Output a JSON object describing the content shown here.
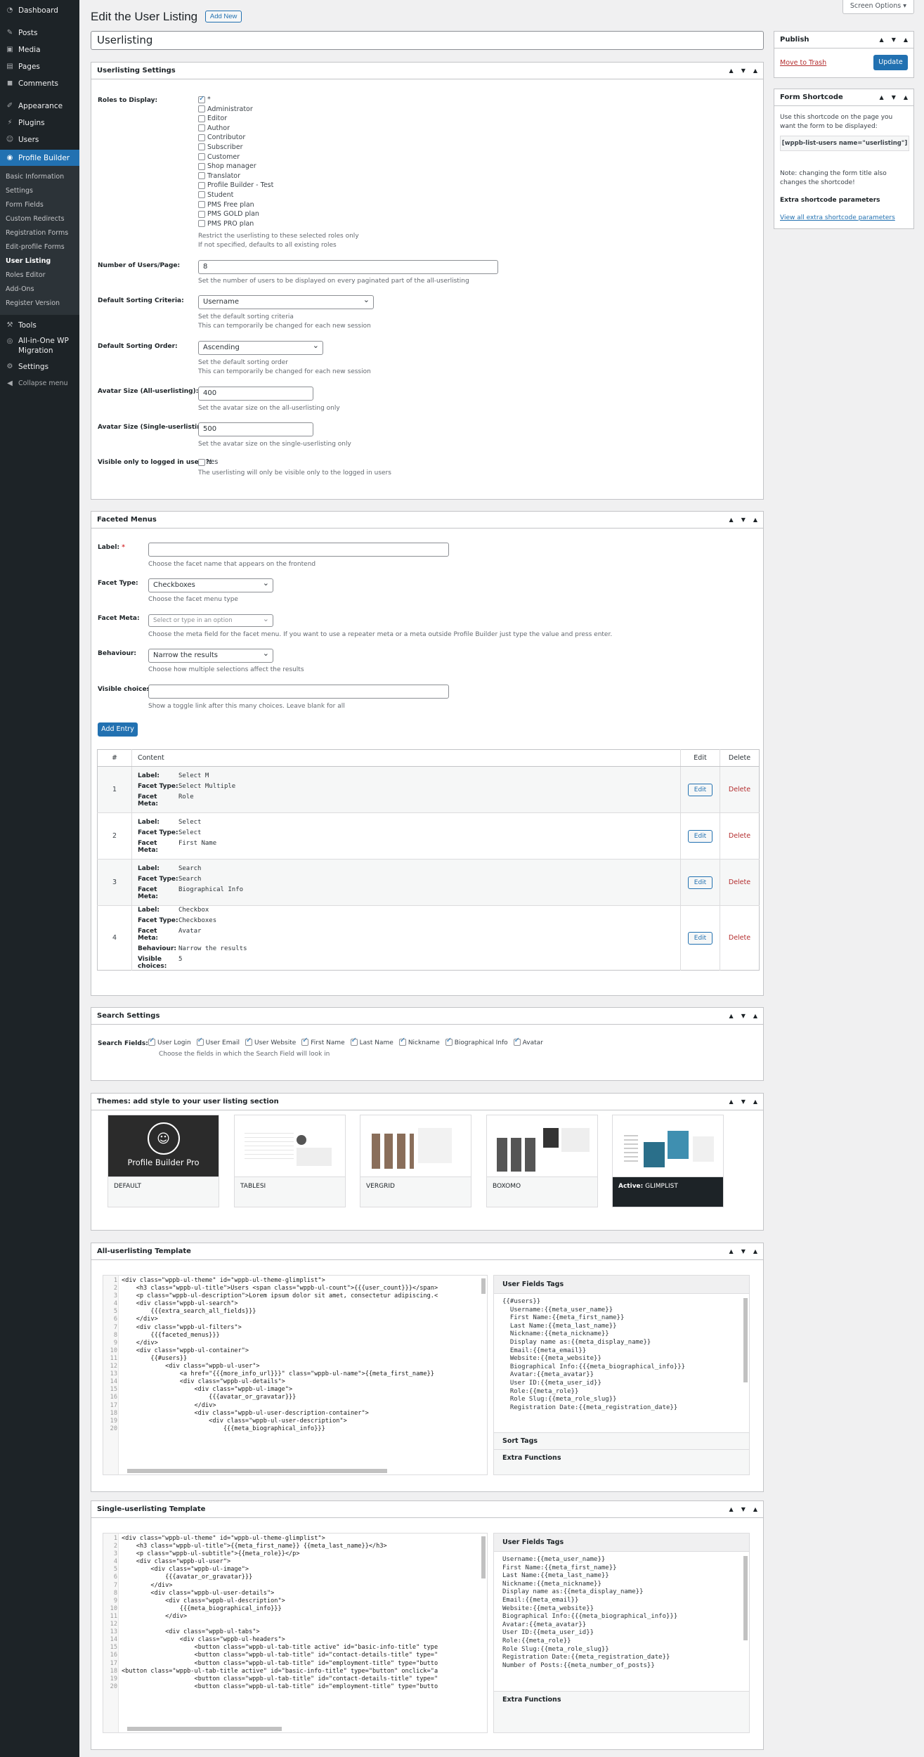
{
  "menu": {
    "items": [
      "Dashboard",
      "Posts",
      "Media",
      "Pages",
      "Comments",
      "Appearance",
      "Plugins",
      "Users",
      "Profile Builder",
      "Tools",
      "All-in-One WP",
      "Migration",
      "Settings",
      "Collapse menu"
    ],
    "sub": [
      "Basic Information",
      "Settings",
      "Form Fields",
      "Custom Redirects",
      "Registration Forms",
      "Edit-profile Forms",
      "User Listing",
      "Roles Editor",
      "Add-Ons",
      "Register Version"
    ]
  },
  "header": {
    "title": "Edit the User Listing",
    "add_new": "Add New",
    "screen_options": "Screen Options ▾",
    "post_title": "Userlisting"
  },
  "settings": {
    "heading": "Userlisting Settings",
    "roles_label": "Roles to Display:",
    "roles": [
      "*",
      "Administrator",
      "Editor",
      "Author",
      "Contributor",
      "Subscriber",
      "Customer",
      "Shop manager",
      "Translator",
      "Profile Builder - Test",
      "Student",
      "PMS Free plan",
      "PMS GOLD plan",
      "PMS PRO plan"
    ],
    "roles_desc1": "Restrict the userlisting to these selected roles only",
    "roles_desc2": "If not specified, defaults to all existing roles",
    "num_label": "Number of Users/Page:",
    "num_value": "8",
    "num_desc": "Set the number of users to be displayed on every paginated part of the all-userlisting",
    "sort_label": "Default Sorting Criteria:",
    "sort_value": "Username",
    "sort_desc1": "Set the default sorting criteria",
    "sort_desc2": "This can temporarily be changed for each new session",
    "order_label": "Default Sorting Order:",
    "order_value": "Ascending",
    "order_desc1": "Set the default sorting order",
    "order_desc2": "This can temporarily be changed for each new session",
    "avatar_all_label": "Avatar Size (All-userlisting):",
    "avatar_all_value": "400",
    "avatar_all_desc": "Set the avatar size on the all-userlisting only",
    "avatar_single_label": "Avatar Size (Single-userlisting):",
    "avatar_single_value": "500",
    "avatar_single_desc": "Set the avatar size on the single-userlisting only",
    "visible_label": "Visible only to logged in users?:",
    "visible_yes": "Yes",
    "visible_desc": "The userlisting will only be visible only to the logged in users"
  },
  "facets": {
    "heading": "Faceted Menus",
    "label_label": "Label:",
    "label_req": "*",
    "label_desc": "Choose the facet name that appears on the frontend",
    "type_label": "Facet Type:",
    "type_value": "Checkboxes",
    "type_desc": "Choose the facet menu type",
    "meta_label": "Facet Meta:",
    "meta_placeholder": "Select or type in an option",
    "meta_desc": "Choose the meta field for the facet menu. If you want to use a repeater meta or a meta outside Profile Builder just type the value and press enter.",
    "behaviour_label": "Behaviour:",
    "behaviour_value": "Narrow the results",
    "behaviour_desc": "Choose how multiple selections affect the results",
    "visible_label": "Visible choices:",
    "visible_desc": "Show a toggle link after this many choices. Leave blank for all",
    "add_entry": "Add Entry",
    "table_headers": [
      "#",
      "Content",
      "Edit",
      "Delete"
    ],
    "edit_label": "Edit",
    "delete_label": "Delete",
    "k_label": "Label:",
    "k_type": "Facet Type:",
    "k_meta": "Facet Meta:",
    "k_behaviour": "Behaviour:",
    "k_visible": "Visible choices:",
    "rows": [
      {
        "n": "1",
        "label": "Select M",
        "type": "Select Multiple",
        "meta": "Role"
      },
      {
        "n": "2",
        "label": "Select",
        "type": "Select",
        "meta": "First Name"
      },
      {
        "n": "3",
        "label": "Search",
        "type": "Search",
        "meta": "Biographical Info"
      },
      {
        "n": "4",
        "label": "Checkbox",
        "type": "Checkboxes",
        "meta": "Avatar",
        "behaviour": "Narrow the results",
        "visible": "5"
      }
    ]
  },
  "search": {
    "heading": "Search Settings",
    "label": "Search Fields:",
    "fields": [
      "User Login",
      "User Email",
      "User Website",
      "First Name",
      "Last Name",
      "Nickname",
      "Biographical Info",
      "Avatar"
    ],
    "desc": "Choose the fields in which the Search Field will look in"
  },
  "themes": {
    "heading": "Themes: add style to your user listing section",
    "items": [
      "DEFAULT",
      "TABLESI",
      "VERGRID",
      "BOXOMO",
      "GLIMPLIST"
    ],
    "active_prefix": "Active:",
    "default_logo": "Profile Builder Pro"
  },
  "all_tpl": {
    "heading": "All-userlisting Template",
    "lines": [
      "<div class=\"wppb-ul-theme\" id=\"wppb-ul-theme-glimplist\">",
      "    <h3 class=\"wppb-ul-title\">Users <span class=\"wppb-ul-count\">{{{user_count}}}</span>",
      "    <p class=\"wppb-ul-description\">Lorem ipsum dolor sit amet, consectetur adipiscing.<",
      "    <div class=\"wppb-ul-search\">",
      "        {{{extra_search_all_fields}}}",
      "    </div>",
      "    <div class=\"wppb-ul-filters\">",
      "        {{{faceted_menus}}}",
      "    </div>",
      "    <div class=\"wppb-ul-container\">",
      "        {{#users}}",
      "            <div class=\"wppb-ul-user\">",
      "                <a href=\"{{{more_info_url}}}\" class=\"wppb-ul-name\">{{meta_first_name}}",
      "                <div class=\"wppb-ul-details\">",
      "                    <div class=\"wppb-ul-image\">",
      "                        {{{avatar_or_gravatar}}}",
      "                    </div>",
      "                    <div class=\"wppb-ul-user-description-container\">",
      "                        <div class=\"wppb-ul-user-description\">",
      "                            {{{meta_biographical_info}}}"
    ],
    "tags_heading": "User Fields Tags",
    "tags": [
      "{{#users}}",
      "  Username:{{meta_user_name}}",
      "  First Name:{{meta_first_name}}",
      "  Last Name:{{meta_last_name}}",
      "  Nickname:{{meta_nickname}}",
      "  Display name as:{{meta_display_name}}",
      "  Email:{{meta_email}}",
      "  Website:{{meta_website}}",
      "  Biographical Info:{{{meta_biographical_info}}}",
      "  Avatar:{{meta_avatar}}",
      "  User ID:{{meta_user_id}}",
      "  Role:{{meta_role}}",
      "  Role Slug:{{meta_role_slug}}",
      "  Registration Date:{{meta_registration_date}}"
    ],
    "sort_tags": "Sort Tags",
    "extra": "Extra Functions"
  },
  "single_tpl": {
    "heading": "Single-userlisting Template",
    "lines": [
      "<div class=\"wppb-ul-theme\" id=\"wppb-ul-theme-glimplist\">",
      "    <h3 class=\"wppb-ul-title\">{{meta_first_name}} {{meta_last_name}}</h3>",
      "    <p class=\"wppb-ul-subtitle\">{{meta_role}}</p>",
      "    <div class=\"wppb-ul-user\">",
      "        <div class=\"wppb-ul-image\">",
      "            {{{avatar_or_gravatar}}}",
      "        </div>",
      "        <div class=\"wppb-ul-user-details\">",
      "            <div class=\"wppb-ul-description\">",
      "                {{{meta_biographical_info}}}",
      "            </div>",
      "",
      "            <div class=\"wppb-ul-tabs\">",
      "                <div class=\"wppb-ul-headers\">",
      "                    <button class=\"wppb-ul-tab-title active\" id=\"basic-info-title\" type",
      "                    <button class=\"wppb-ul-tab-title\" id=\"contact-details-title\" type=\"",
      "                    <button class=\"wppb-ul-tab-title\" id=\"employment-title\" type=\"butto",
      "<button class=\"wppb-ul-tab-title active\" id=\"basic-info-title\" type=\"button\" onclick=\"a",
      "                    <button class=\"wppb-ul-tab-title\" id=\"contact-details-title\" type=\"",
      "                    <button class=\"wppb-ul-tab-title\" id=\"employment-title\" type=\"butto"
    ],
    "tags_heading": "User Fields Tags",
    "tags": [
      "Username:{{meta_user_name}}",
      "First Name:{{meta_first_name}}",
      "Last Name:{{meta_last_name}}",
      "Nickname:{{meta_nickname}}",
      "Display name as:{{meta_display_name}}",
      "Email:{{meta_email}}",
      "Website:{{meta_website}}",
      "Biographical Info:{{{meta_biographical_info}}}",
      "Avatar:{{meta_avatar}}",
      "User ID:{{meta_user_id}}",
      "Role:{{meta_role}}",
      "Role Slug:{{meta_role_slug}}",
      "Registration Date:{{meta_registration_date}}",
      "Number of Posts:{{meta_number_of_posts}}"
    ],
    "extra": "Extra Functions"
  },
  "publish": {
    "heading": "Publish",
    "trash": "Move to Trash",
    "update": "Update"
  },
  "shortcode": {
    "heading": "Form Shortcode",
    "desc": "Use this shortcode on the page you want the form to be displayed:",
    "code": "[wppb-list-users name=\"userlisting\"]",
    "note": "Note: changing the form title also changes the shortcode!",
    "extra_title": "Extra shortcode parameters",
    "link": "View all extra shortcode parameters"
  }
}
